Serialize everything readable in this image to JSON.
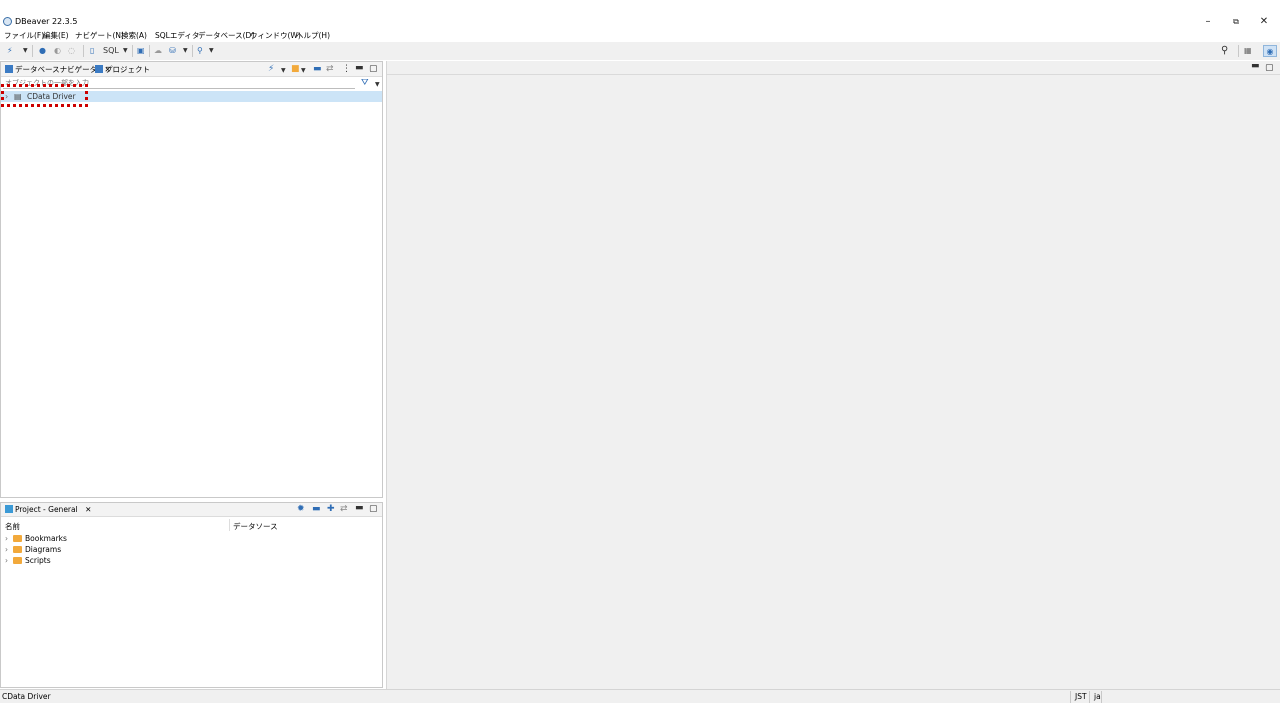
{
  "window": {
    "title": "DBeaver 22.3.5",
    "controls": {
      "minimize": "–",
      "restore": "⧉",
      "close": "✕"
    }
  },
  "menu": [
    "ファイル(F)",
    "編集(E)",
    "ナビゲート(N)",
    "検索(A)",
    "SQLエディタ",
    "データベース(D)",
    "ウィンドウ(W)",
    "ヘルプ(H)"
  ],
  "toolbar": {
    "sql_label": "SQL"
  },
  "navigator": {
    "tab_active": "データベースナビゲータ",
    "tab_other": "プロジェクト",
    "filter_placeholder": "オブジェクトの一部を入力",
    "tree": [
      {
        "label": "CData Driver",
        "selected": true
      }
    ]
  },
  "project": {
    "tab": "Project - General",
    "columns": [
      "名前",
      "データソース"
    ],
    "items": [
      "Bookmarks",
      "Diagrams",
      "Scripts"
    ]
  },
  "status": {
    "left": "CData Driver",
    "timezone": "JST",
    "locale": "ja"
  },
  "icons": {
    "app": "dbeaver-icon",
    "search": "search-icon",
    "filter": "filter-icon",
    "folder": "folder-icon",
    "database": "database-icon"
  },
  "colors": {
    "selection": "#cce4f7",
    "highlight_box": "#cc0000",
    "folder": "#f2a93b"
  }
}
